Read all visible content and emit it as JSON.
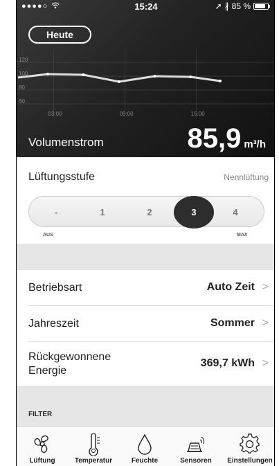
{
  "status_bar": {
    "signal": "●●●●○",
    "wifi_icon": "wifi-icon",
    "time": "15:24",
    "battery_text": "85 %",
    "battery_level": 0.85
  },
  "hero": {
    "day_button": "Heute",
    "metric_label": "Volumenstrom",
    "metric_value": "85,9",
    "metric_unit": "m³/h"
  },
  "chart_data": {
    "type": "line",
    "y_ticks": [
      "120",
      "100",
      "80",
      "60"
    ],
    "x_ticks": [
      "03:00",
      "09:00",
      "15:00"
    ],
    "ylim": [
      50,
      130
    ],
    "grid": true,
    "x": [
      0,
      2.5,
      5.5,
      8.5,
      11.5,
      14.5,
      17
    ],
    "values": [
      98,
      103,
      102,
      92,
      100,
      99,
      93
    ],
    "line_color": "#dddddd"
  },
  "lueftung": {
    "title": "Lüftungsstufe",
    "mode": "Nennlüftung",
    "steps": [
      "-",
      "1",
      "2",
      "3",
      "4"
    ],
    "active_index": 3,
    "min_label": "AUS",
    "max_label": "MAX"
  },
  "settings": [
    {
      "label": "Betriebsart",
      "value": "Auto Zeit"
    },
    {
      "label": "Jahreszeit",
      "value": "Sommer"
    },
    {
      "label": "Rückgewonnene Energie",
      "value": "369,7 kWh"
    }
  ],
  "chevron": ">",
  "filter": {
    "label": "FILTER"
  },
  "tabs": [
    {
      "label": "Lüftung",
      "icon": "fan-icon"
    },
    {
      "label": "Temperatur",
      "icon": "thermometer-icon"
    },
    {
      "label": "Feuchte",
      "icon": "droplet-icon"
    },
    {
      "label": "Sensoren",
      "icon": "sensor-icon"
    },
    {
      "label": "Einstellungen",
      "icon": "gear-icon"
    }
  ],
  "colors": {
    "hero_bg": "#222222",
    "active_step": "#2d2d2d",
    "gray_section": "#e6e6e6"
  }
}
